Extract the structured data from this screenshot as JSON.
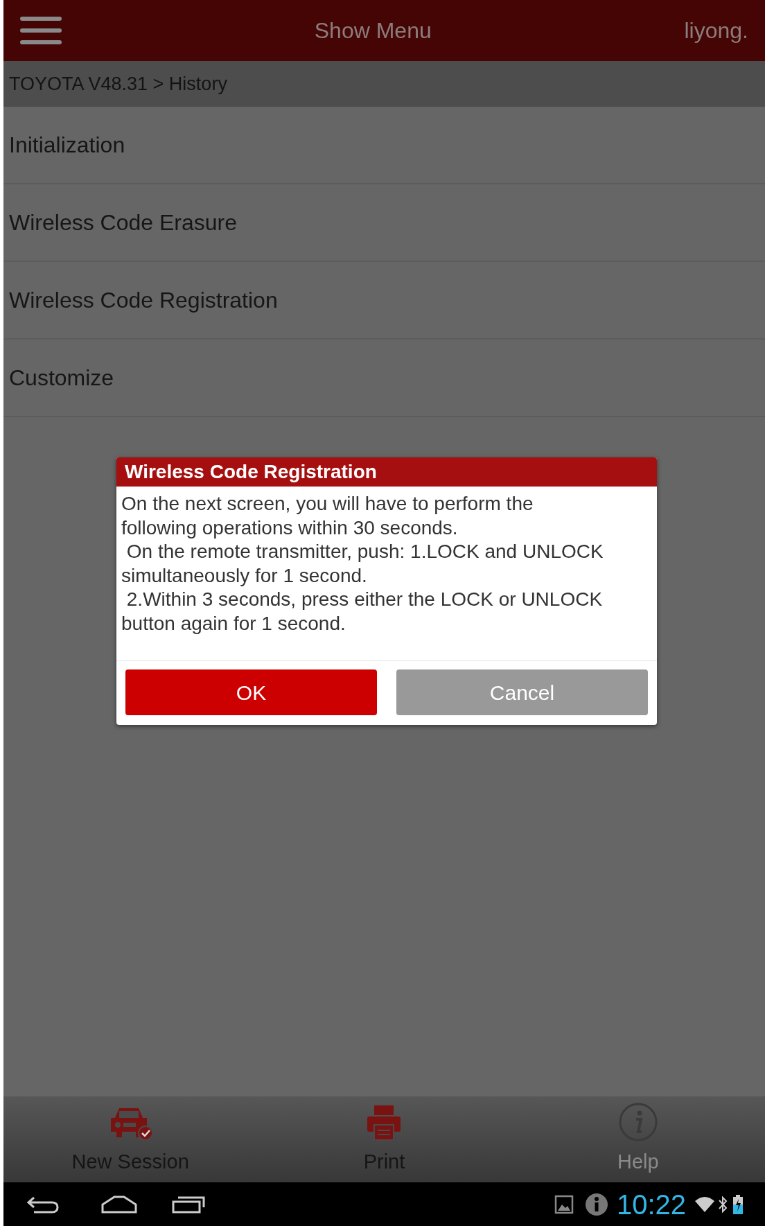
{
  "top_bar": {
    "title": "Show Menu",
    "user": "liyong."
  },
  "breadcrumb": "TOYOTA V48.31 > History",
  "menu_items": [
    {
      "label": "Initialization"
    },
    {
      "label": "Wireless Code Erasure"
    },
    {
      "label": "Wireless Code Registration"
    },
    {
      "label": "Customize"
    }
  ],
  "dialog": {
    "title": "Wireless Code Registration",
    "lines": [
      "On the next screen, you will have to perform the",
      "following operations within 30 seconds.",
      " On the remote transmitter, push: 1.LOCK and UNLOCK",
      "simultaneously for 1 second.",
      " 2.Within 3 seconds, press either the LOCK or UNLOCK",
      "button again for 1 second."
    ],
    "buttons": [
      {
        "label": "OK",
        "kind": "primary"
      },
      {
        "label": "Cancel",
        "kind": "secondary"
      }
    ]
  },
  "bottom_bar": [
    {
      "label": "New Session",
      "kind": "car",
      "disabled": false
    },
    {
      "label": "Print",
      "kind": "printer",
      "disabled": false
    },
    {
      "label": "Help",
      "kind": "info",
      "disabled": true
    }
  ],
  "status_bar": {
    "time": "10:22"
  }
}
